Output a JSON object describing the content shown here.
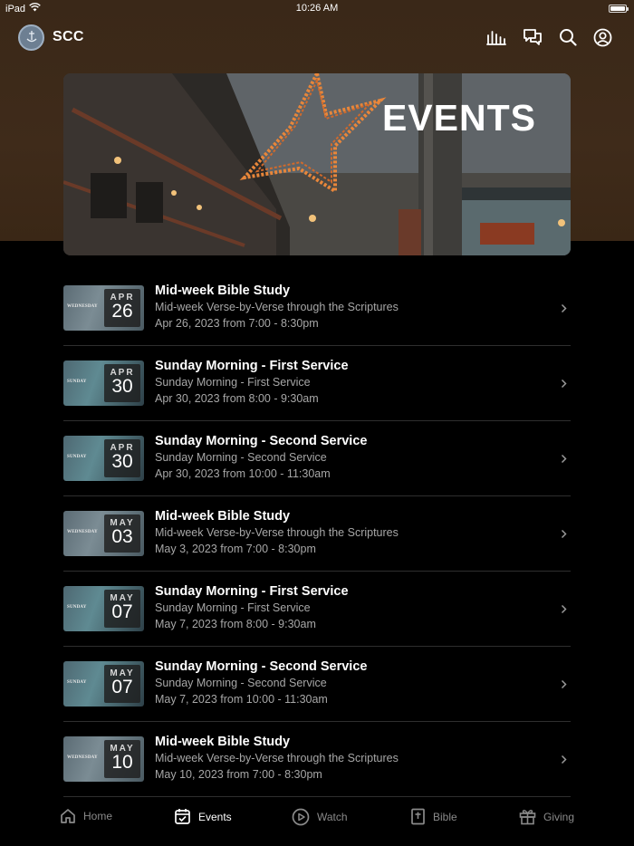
{
  "status_bar": {
    "device": "iPad",
    "time": "10:26 AM"
  },
  "header": {
    "brand": "SCC"
  },
  "banner": {
    "title": "EVENTS"
  },
  "events": [
    {
      "title": "Mid-week Bible Study",
      "subtitle": "Mid-week Verse-by-Verse through the Scriptures",
      "when": "Apr 26, 2023 from 7:00 - 8:30pm",
      "month": "APR",
      "day": "26",
      "thumb_label": "WEDNESDAY"
    },
    {
      "title": "Sunday Morning - First Service",
      "subtitle": "Sunday Morning - First Service",
      "when": "Apr 30, 2023 from 8:00 - 9:30am",
      "month": "APR",
      "day": "30",
      "thumb_label": "SUNDAY"
    },
    {
      "title": "Sunday Morning - Second Service",
      "subtitle": "Sunday Morning - Second Service",
      "when": "Apr 30, 2023 from 10:00 - 11:30am",
      "month": "APR",
      "day": "30",
      "thumb_label": "SUNDAY"
    },
    {
      "title": "Mid-week Bible Study",
      "subtitle": "Mid-week Verse-by-Verse through the Scriptures",
      "when": "May 3, 2023 from 7:00 - 8:30pm",
      "month": "MAY",
      "day": "03",
      "thumb_label": "WEDNESDAY"
    },
    {
      "title": "Sunday Morning - First Service",
      "subtitle": "Sunday Morning - First Service",
      "when": "May 7, 2023 from 8:00 - 9:30am",
      "month": "MAY",
      "day": "07",
      "thumb_label": "SUNDAY"
    },
    {
      "title": "Sunday Morning - Second Service",
      "subtitle": "Sunday Morning - Second Service",
      "when": "May 7, 2023 from 10:00 - 11:30am",
      "month": "MAY",
      "day": "07",
      "thumb_label": "SUNDAY"
    },
    {
      "title": "Mid-week Bible Study",
      "subtitle": "Mid-week Verse-by-Verse through the Scriptures",
      "when": "May 10, 2023 from 7:00 - 8:30pm",
      "month": "MAY",
      "day": "10",
      "thumb_label": "WEDNESDAY"
    }
  ],
  "tabs": [
    {
      "label": "Home",
      "icon": "home-icon",
      "active": false
    },
    {
      "label": "Events",
      "icon": "calendar-icon",
      "active": true
    },
    {
      "label": "Watch",
      "icon": "play-icon",
      "active": false
    },
    {
      "label": "Bible",
      "icon": "bible-icon",
      "active": false
    },
    {
      "label": "Giving",
      "icon": "gift-icon",
      "active": false
    }
  ],
  "colors": {
    "header_bg": "#3f2b1a",
    "background": "#000000",
    "text_secondary": "#a7a7a7",
    "tab_inactive": "#8a8a8a"
  }
}
